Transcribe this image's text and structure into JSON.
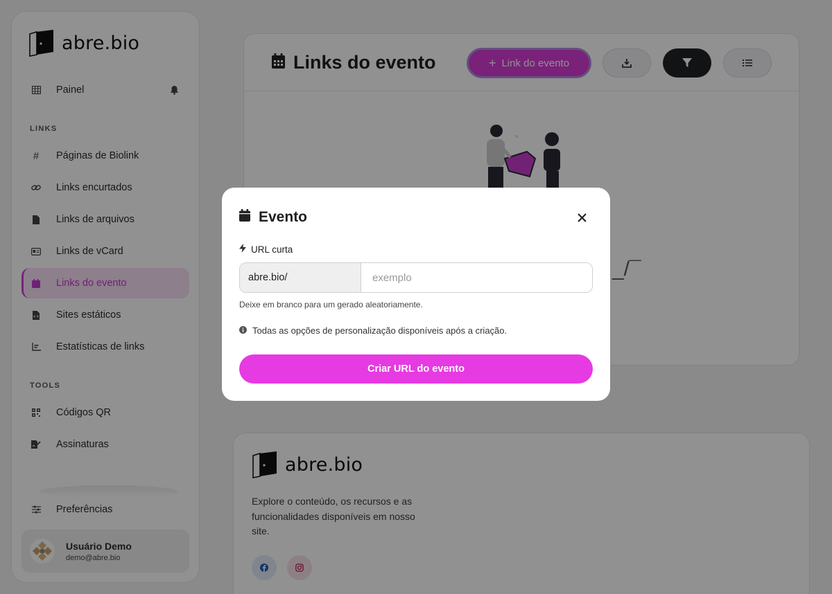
{
  "brand": {
    "name": "abre.bio"
  },
  "sidebar": {
    "dashboard": {
      "label": "Painel"
    },
    "sections": {
      "links": "LINKS",
      "tools": "TOOLS"
    },
    "links_items": [
      {
        "label": "Páginas de Biolink",
        "icon": "hash-icon"
      },
      {
        "label": "Links encurtados",
        "icon": "link-icon"
      },
      {
        "label": "Links de arquivos",
        "icon": "file-icon"
      },
      {
        "label": "Links de vCard",
        "icon": "id-card-icon"
      },
      {
        "label": "Links do evento",
        "icon": "calendar-icon",
        "active": true
      },
      {
        "label": "Sites estáticos",
        "icon": "file-code-icon"
      },
      {
        "label": "Estatísticas de links",
        "icon": "chart-icon"
      }
    ],
    "tools_items": [
      {
        "label": "Códigos QR",
        "icon": "qrcode-icon"
      },
      {
        "label": "Assinaturas",
        "icon": "signature-icon"
      }
    ],
    "preferences": {
      "label": "Preferências"
    },
    "user": {
      "name": "Usuário Demo",
      "email": "demo@abre.bio"
    }
  },
  "main": {
    "title": "Links do evento",
    "add_button": "Link do evento",
    "empty_shrug": "_/¯"
  },
  "footer": {
    "description": "Explore o conteúdo, os recursos e as funcionalidades disponíveis em nosso site."
  },
  "modal": {
    "title": "Evento",
    "field_label": "URL curta",
    "prefix": "abre.bio/",
    "placeholder": "exemplo",
    "help": "Deixe em branco para um gerado aleatoriamente.",
    "info": "Todas as opções de personalização disponíveis após a criação.",
    "submit": "Criar URL do evento"
  },
  "colors": {
    "accent": "#e63ae2",
    "active_bg": "#f8dff6",
    "dark_button": "#1f2225"
  }
}
